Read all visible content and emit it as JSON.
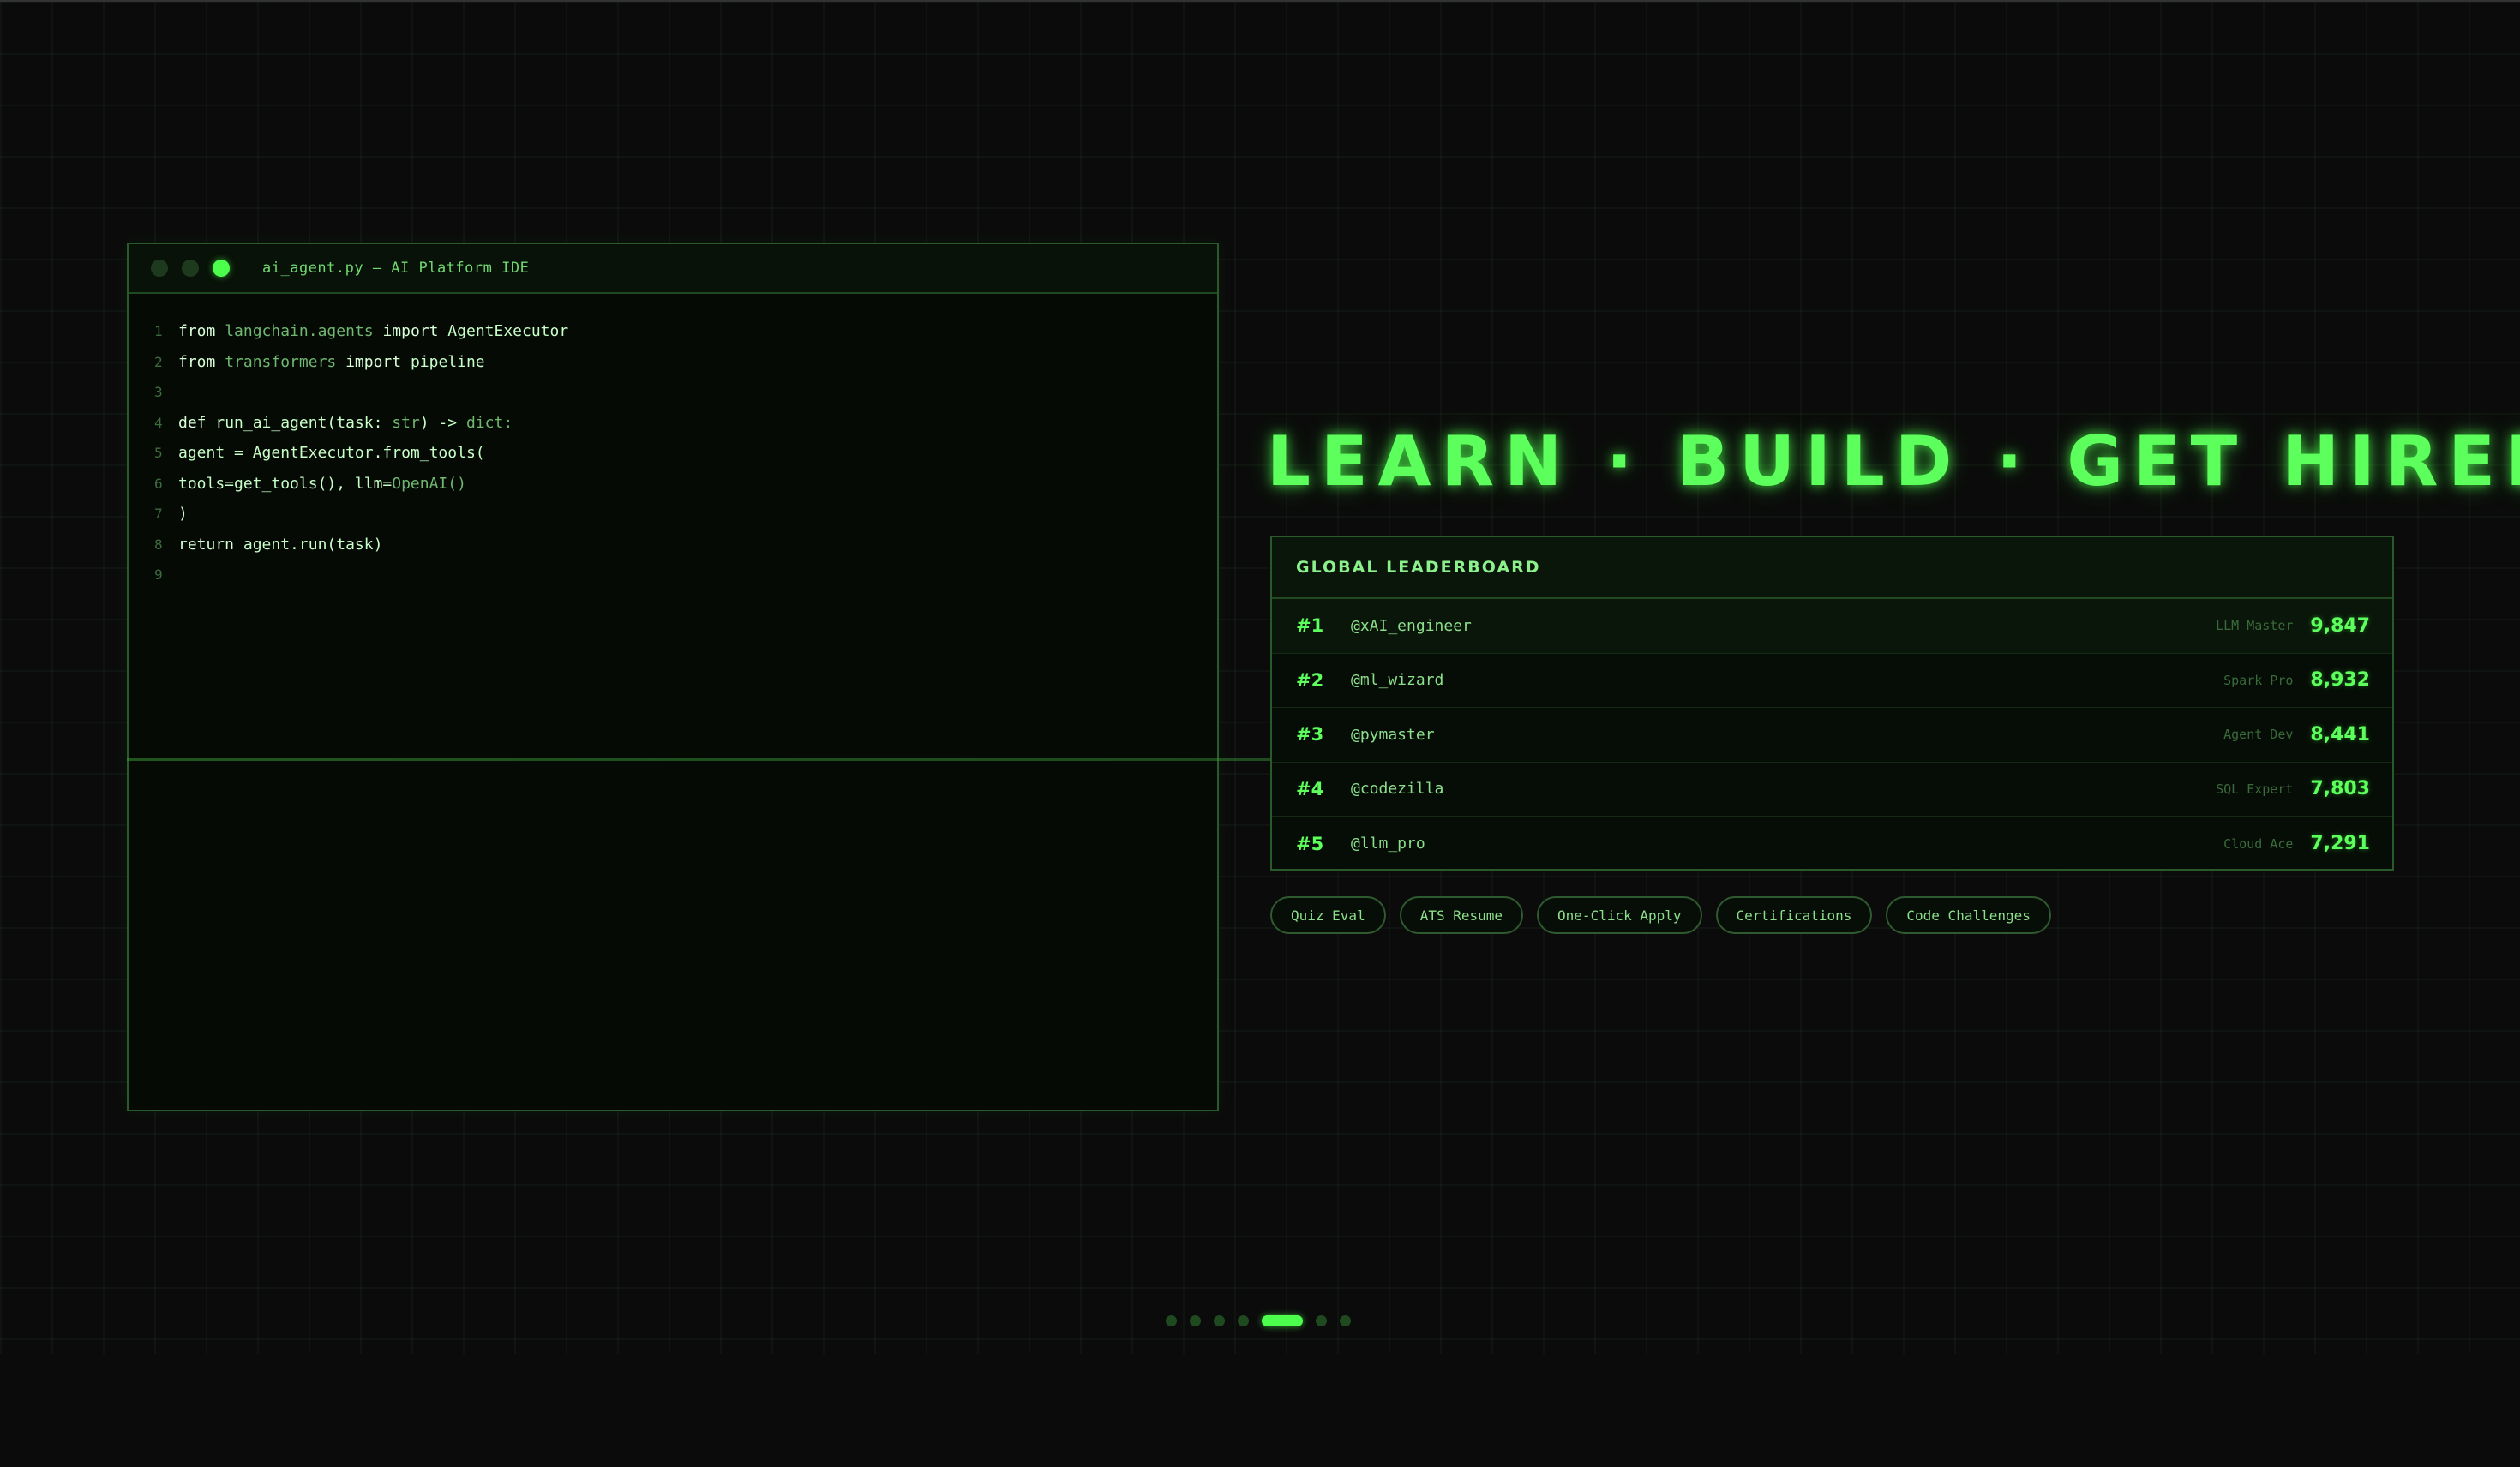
{
  "ide": {
    "title": "ai_agent.py — AI Platform IDE",
    "lines": [
      {
        "num": "1",
        "parts": [
          {
            "t": "from",
            "c": "kw"
          },
          {
            "t": " langchain.agents ",
            "c": "mod"
          },
          {
            "t": "import",
            "c": "kw"
          },
          {
            "t": " AgentExecutor",
            "c": "fn"
          }
        ]
      },
      {
        "num": "2",
        "parts": [
          {
            "t": "from",
            "c": "kw"
          },
          {
            "t": " transformers ",
            "c": "mod"
          },
          {
            "t": "import",
            "c": "kw"
          },
          {
            "t": " pipeline",
            "c": "fn"
          }
        ]
      },
      {
        "num": "3",
        "parts": []
      },
      {
        "num": "4",
        "parts": [
          {
            "t": "def",
            "c": "kw"
          },
          {
            "t": " run_ai_agent(task: ",
            "c": "fn"
          },
          {
            "t": "str",
            "c": "ty"
          },
          {
            "t": ") -> ",
            "c": "fn"
          },
          {
            "t": "dict:",
            "c": "ty"
          }
        ]
      },
      {
        "num": "5",
        "parts": [
          {
            "t": "agent = AgentExecutor.from_tools(",
            "c": "fn"
          }
        ]
      },
      {
        "num": "6",
        "parts": [
          {
            "t": "tools=get_tools(), llm=",
            "c": "fn"
          },
          {
            "t": "OpenAI()",
            "c": "ty"
          }
        ]
      },
      {
        "num": "7",
        "parts": [
          {
            "t": ")",
            "c": "fn"
          }
        ]
      },
      {
        "num": "8",
        "parts": [
          {
            "t": "return",
            "c": "kw"
          },
          {
            "t": " agent.run(task)",
            "c": "fn"
          }
        ]
      },
      {
        "num": "9",
        "parts": []
      }
    ]
  },
  "headline": "LEARN · BUILD · GET HIRED",
  "leaderboard": {
    "title": "GLOBAL LEADERBOARD",
    "rows": [
      {
        "rank": "#1",
        "user": "@xAI_engineer",
        "role": "LLM Master",
        "score": "9,847"
      },
      {
        "rank": "#2",
        "user": "@ml_wizard",
        "role": "Spark Pro",
        "score": "8,932"
      },
      {
        "rank": "#3",
        "user": "@pymaster",
        "role": "Agent Dev",
        "score": "8,441"
      },
      {
        "rank": "#4",
        "user": "@codezilla",
        "role": "SQL Expert",
        "score": "7,803"
      },
      {
        "rank": "#5",
        "user": "@llm_pro",
        "role": "Cloud Ace",
        "score": "7,291"
      }
    ]
  },
  "pills": [
    "Quiz Eval",
    "ATS Resume",
    "One-Click Apply",
    "Certifications",
    "Code Challenges"
  ],
  "pager": {
    "count": 7,
    "active_index": 4
  },
  "colors": {
    "accent": "#4cff4c",
    "background": "#0b0b0b",
    "border": "#2a5a2a"
  }
}
